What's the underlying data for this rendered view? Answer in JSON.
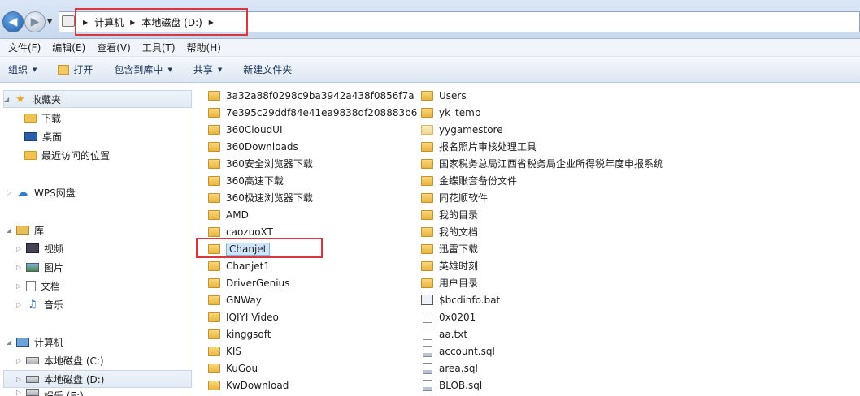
{
  "address": {
    "back_icon": "back-arrow-icon",
    "forward_icon": "forward-arrow-icon",
    "breadcrumb": [
      "计算机",
      "本地磁盘 (D:)"
    ]
  },
  "menu": [
    "文件(F)",
    "编辑(E)",
    "查看(V)",
    "工具(T)",
    "帮助(H)"
  ],
  "toolbar": {
    "organize": "组织",
    "open": "打开",
    "include_library": "包含到库中",
    "share": "共享",
    "new_folder": "新建文件夹"
  },
  "nav": {
    "favorites": "收藏夹",
    "downloads": "下载",
    "desktop": "桌面",
    "recent": "最近访问的位置",
    "wps": "WPS网盘",
    "libraries": "库",
    "videos": "视频",
    "pictures": "图片",
    "documents": "文档",
    "music": "音乐",
    "computer": "计算机",
    "drive_c": "本地磁盘 (C:)",
    "drive_d": "本地磁盘 (D:)",
    "drive_e_partial": "娱乐 (E:)"
  },
  "files_col1": [
    {
      "name": "3a32a88f0298c9ba3942a438f0856f7a",
      "type": "folder"
    },
    {
      "name": "7e395c29ddf84e41ea9838df208883b6",
      "type": "folder"
    },
    {
      "name": "360CloudUI",
      "type": "folder"
    },
    {
      "name": "360Downloads",
      "type": "folder"
    },
    {
      "name": "360安全浏览器下载",
      "type": "folder"
    },
    {
      "name": "360高速下载",
      "type": "folder"
    },
    {
      "name": "360极速浏览器下载",
      "type": "folder"
    },
    {
      "name": "AMD",
      "type": "folder"
    },
    {
      "name": "caozuoXT",
      "type": "folder"
    },
    {
      "name": "Chanjet",
      "type": "folder",
      "selected": true
    },
    {
      "name": "Chanjet1",
      "type": "folder"
    },
    {
      "name": "DriverGenius",
      "type": "folder"
    },
    {
      "name": "GNWay",
      "type": "folder"
    },
    {
      "name": "IQIYI Video",
      "type": "folder"
    },
    {
      "name": "kinggsoft",
      "type": "folder"
    },
    {
      "name": "KIS",
      "type": "folder"
    },
    {
      "name": "KuGou",
      "type": "folder"
    },
    {
      "name": "KwDownload",
      "type": "folder"
    }
  ],
  "files_col2": [
    {
      "name": "Users",
      "type": "folder"
    },
    {
      "name": "yk_temp",
      "type": "folder"
    },
    {
      "name": "yygamestore",
      "type": "folder-light"
    },
    {
      "name": "报名照片审核处理工具",
      "type": "folder"
    },
    {
      "name": "国家税务总局江西省税务局企业所得税年度申报系统",
      "type": "folder"
    },
    {
      "name": "金蝶账套备份文件",
      "type": "folder"
    },
    {
      "name": "同花顺软件",
      "type": "folder"
    },
    {
      "name": "我的目录",
      "type": "folder"
    },
    {
      "name": "我的文档",
      "type": "folder"
    },
    {
      "name": "迅雷下载",
      "type": "folder"
    },
    {
      "name": "英雄时刻",
      "type": "folder"
    },
    {
      "name": "用户目录",
      "type": "folder"
    },
    {
      "name": "$bcdinfo.bat",
      "type": "bat"
    },
    {
      "name": "0x0201",
      "type": "txt"
    },
    {
      "name": "aa.txt",
      "type": "txt"
    },
    {
      "name": "account.sql",
      "type": "sql"
    },
    {
      "name": "area.sql",
      "type": "sql"
    },
    {
      "name": "BLOB.sql",
      "type": "sql"
    }
  ],
  "highlight_color": "#d9363e"
}
